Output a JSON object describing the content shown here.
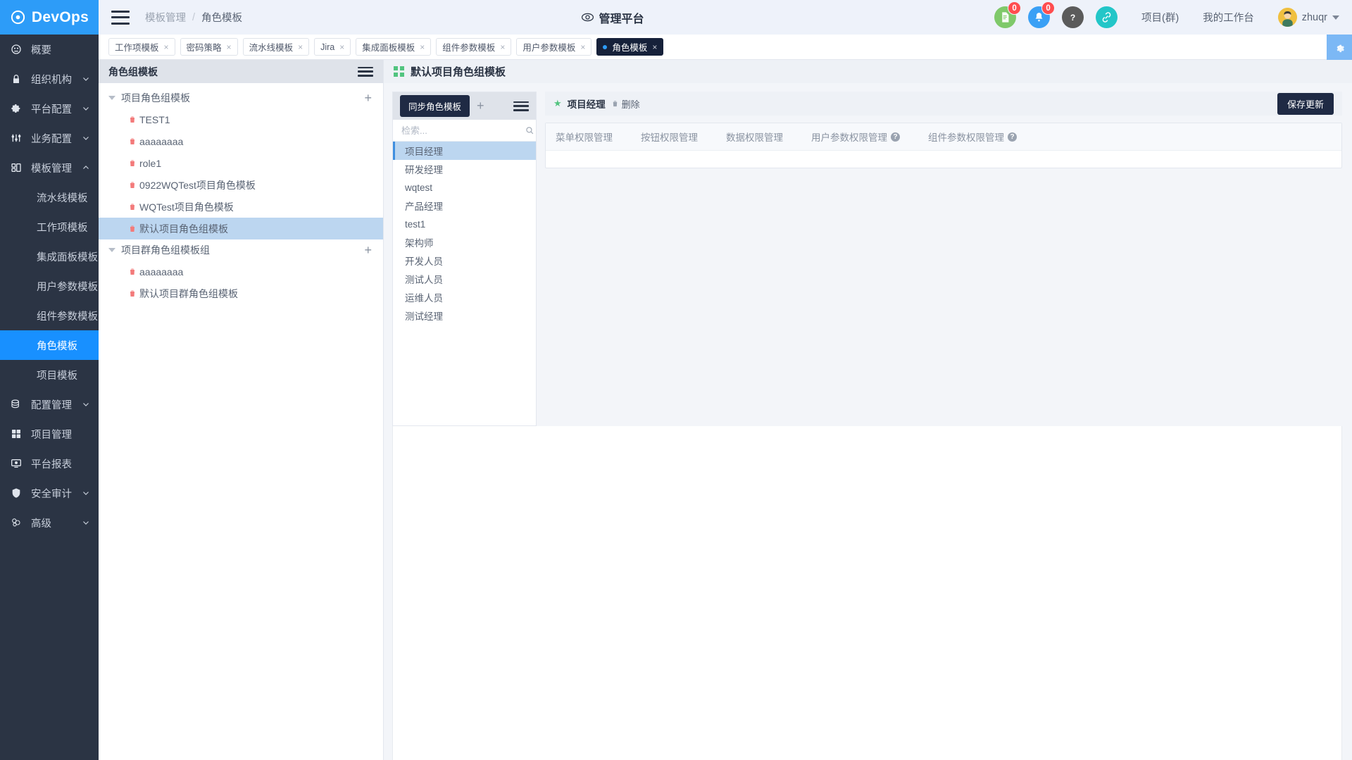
{
  "brand": {
    "name": "DevOps"
  },
  "header": {
    "breadcrumb": {
      "parent": "模板管理",
      "sep": "/",
      "current": "角色模板"
    },
    "center_title": "管理平台",
    "icons": [
      {
        "name": "document-icon",
        "badge": "0",
        "color": "#7fc96a"
      },
      {
        "name": "bell-icon",
        "badge": "0",
        "color": "#3aa0f5"
      },
      {
        "name": "help-icon",
        "badge": "",
        "color": "#5b5b5b"
      },
      {
        "name": "link-icon",
        "badge": "",
        "color": "#23c6c8"
      }
    ],
    "links": [
      {
        "label": "项目(群)"
      },
      {
        "label": "我的工作台"
      }
    ],
    "user": {
      "name": "zhuqr"
    }
  },
  "tabs": [
    {
      "label": "工作项模板",
      "active": false
    },
    {
      "label": "密码策略",
      "active": false
    },
    {
      "label": "流水线模板",
      "active": false
    },
    {
      "label": "Jira",
      "active": false
    },
    {
      "label": "集成面板模板",
      "active": false
    },
    {
      "label": "组件参数模板",
      "active": false
    },
    {
      "label": "用户参数模板",
      "active": false
    },
    {
      "label": "角色模板",
      "active": true
    }
  ],
  "sidebar": {
    "items": [
      {
        "label": "概要",
        "icon": "overview-icon",
        "chevron": "",
        "active": false,
        "sub": false
      },
      {
        "label": "组织机构",
        "icon": "lock-icon",
        "chevron": "down",
        "active": false,
        "sub": false
      },
      {
        "label": "平台配置",
        "icon": "gear-icon",
        "chevron": "down",
        "active": false,
        "sub": false
      },
      {
        "label": "业务配置",
        "icon": "sliders-icon",
        "chevron": "down",
        "active": false,
        "sub": false
      },
      {
        "label": "模板管理",
        "icon": "template-icon",
        "chevron": "up",
        "active": false,
        "sub": false
      },
      {
        "label": "流水线模板",
        "icon": "",
        "chevron": "",
        "active": false,
        "sub": true
      },
      {
        "label": "工作项模板",
        "icon": "",
        "chevron": "",
        "active": false,
        "sub": true
      },
      {
        "label": "集成面板模板",
        "icon": "",
        "chevron": "",
        "active": false,
        "sub": true
      },
      {
        "label": "用户参数模板",
        "icon": "",
        "chevron": "",
        "active": false,
        "sub": true
      },
      {
        "label": "组件参数模板",
        "icon": "",
        "chevron": "",
        "active": false,
        "sub": true
      },
      {
        "label": "角色模板",
        "icon": "",
        "chevron": "",
        "active": true,
        "sub": true
      },
      {
        "label": "项目模板",
        "icon": "",
        "chevron": "",
        "active": false,
        "sub": true
      },
      {
        "label": "配置管理",
        "icon": "database-icon",
        "chevron": "down",
        "active": false,
        "sub": false
      },
      {
        "label": "项目管理",
        "icon": "squares-icon",
        "chevron": "",
        "active": false,
        "sub": false
      },
      {
        "label": "平台报表",
        "icon": "monitor-icon",
        "chevron": "",
        "active": false,
        "sub": false
      },
      {
        "label": "安全审计",
        "icon": "shield-icon",
        "chevron": "down",
        "active": false,
        "sub": false
      },
      {
        "label": "高级",
        "icon": "advanced-icon",
        "chevron": "down",
        "active": false,
        "sub": false
      }
    ]
  },
  "tree_panel": {
    "title": "角色组模板",
    "groups": [
      {
        "label": "项目角色组模板",
        "add_label": "+",
        "nodes": [
          {
            "label": "TEST1",
            "selected": false
          },
          {
            "label": "aaaaaaaa",
            "selected": false
          },
          {
            "label": "role1",
            "selected": false
          },
          {
            "label": "0922WQTest项目角色模板",
            "selected": false
          },
          {
            "label": "WQTest项目角色模板",
            "selected": false
          },
          {
            "label": "默认项目角色组模板",
            "selected": true
          }
        ]
      },
      {
        "label": "项目群角色组模板组",
        "add_label": "+",
        "nodes": [
          {
            "label": "aaaaaaaa",
            "selected": false
          },
          {
            "label": "默认项目群角色组模板",
            "selected": false
          }
        ]
      }
    ]
  },
  "content": {
    "title": "默认项目角色组模板",
    "role_panel": {
      "sync_button": "同步角色模板",
      "add_label": "+",
      "search_placeholder": "检索...",
      "search_value": "",
      "roles": [
        {
          "label": "项目经理",
          "selected": true
        },
        {
          "label": "研发经理",
          "selected": false
        },
        {
          "label": "wqtest",
          "selected": false
        },
        {
          "label": "产品经理",
          "selected": false
        },
        {
          "label": "test1",
          "selected": false
        },
        {
          "label": "架构师",
          "selected": false
        },
        {
          "label": "开发人员",
          "selected": false
        },
        {
          "label": "测试人员",
          "selected": false
        },
        {
          "label": "运维人员",
          "selected": false
        },
        {
          "label": "测试经理",
          "selected": false
        }
      ]
    },
    "detail": {
      "role_name": "项目经理",
      "delete_label": "删除",
      "save_label": "保存更新",
      "tabs": [
        {
          "label": "菜单权限管理",
          "help": false
        },
        {
          "label": "按钮权限管理",
          "help": false
        },
        {
          "label": "数据权限管理",
          "help": false
        },
        {
          "label": "用户参数权限管理",
          "help": true
        },
        {
          "label": "组件参数权限管理",
          "help": true
        }
      ]
    }
  },
  "colors": {
    "brand": "#2d9cf8",
    "nav_bg": "#2b3444",
    "accent_dark": "#1f2a44",
    "selected": "#bcd6f0"
  }
}
